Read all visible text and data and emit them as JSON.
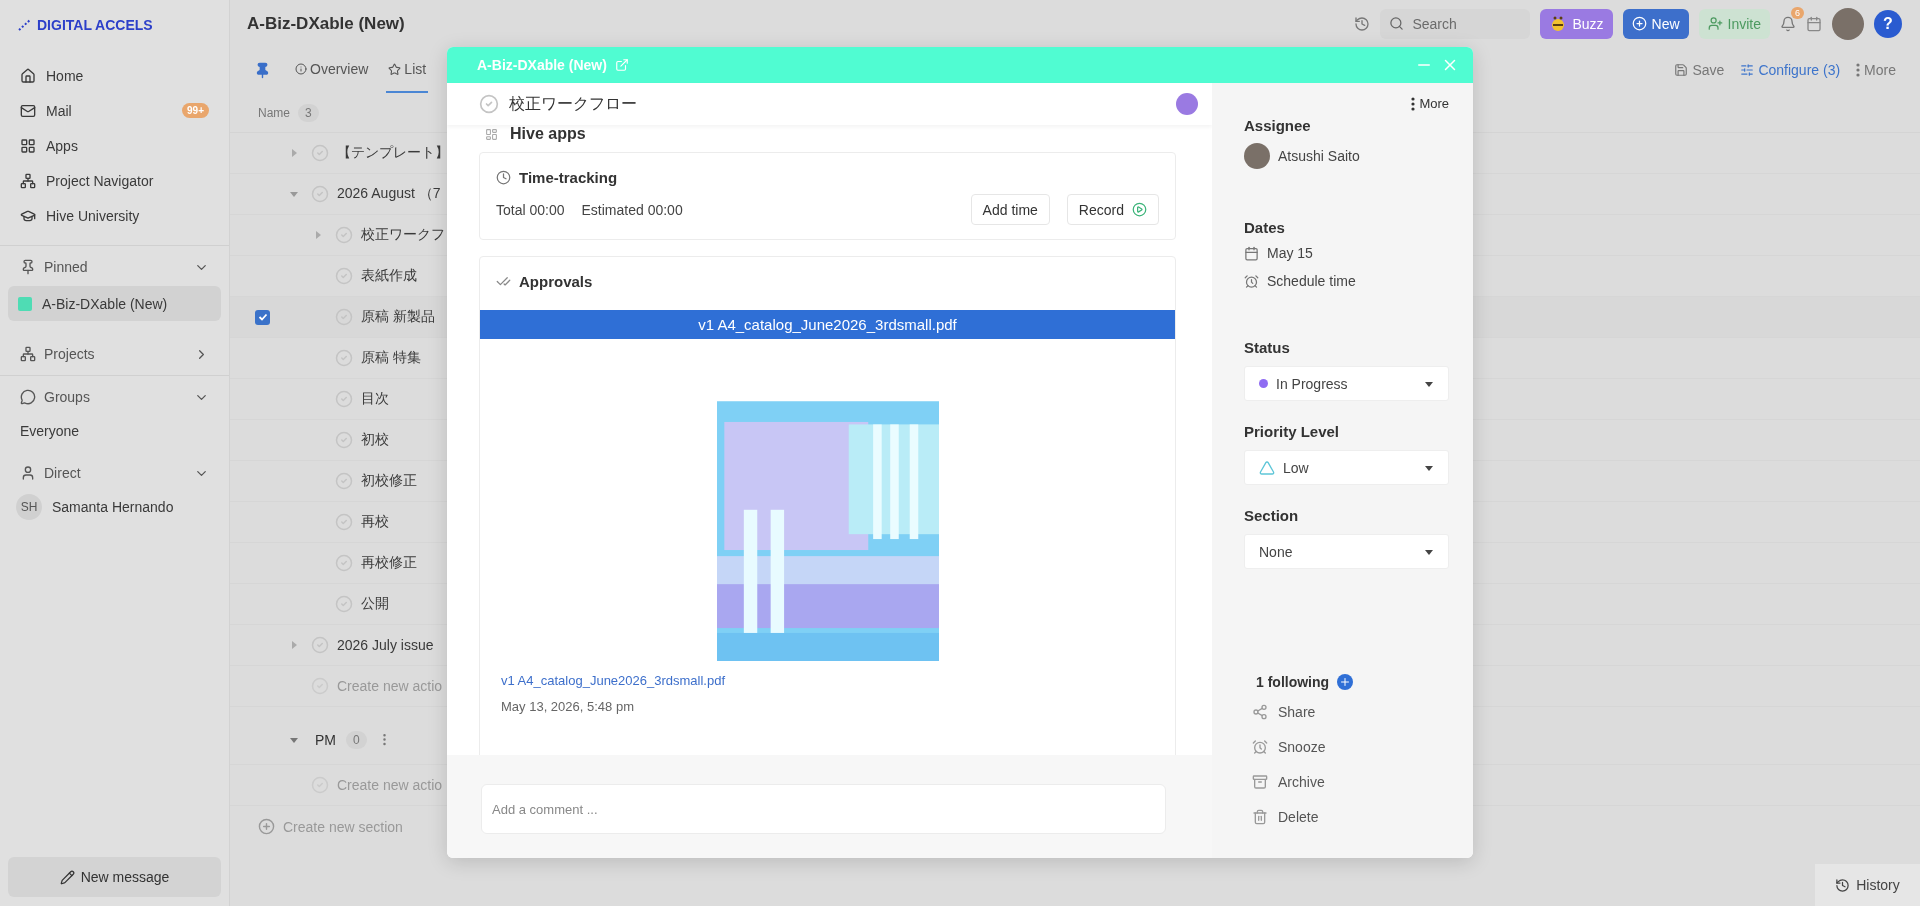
{
  "sidebar": {
    "brand": "DIGITAL ACCELS",
    "nav": [
      {
        "label": "Home"
      },
      {
        "label": "Mail",
        "badge": "99+"
      },
      {
        "label": "Apps"
      },
      {
        "label": "Project Navigator"
      },
      {
        "label": "Hive University"
      }
    ],
    "pinned": {
      "label": "Pinned",
      "expanded": true,
      "items": [
        {
          "label": "A-Biz-DXable (New)",
          "selected": true,
          "color": "#4fdcb4"
        }
      ]
    },
    "projects": {
      "label": "Projects",
      "expanded": false
    },
    "groups": {
      "label": "Groups",
      "expanded": true,
      "items": [
        "Everyone"
      ]
    },
    "direct": {
      "label": "Direct",
      "expanded": true,
      "items": [
        {
          "initials": "SH",
          "name": "Samanta Hernando"
        }
      ]
    },
    "new_message": "New message"
  },
  "topbar": {
    "title": "A-Biz-DXable (New)",
    "search_placeholder": "Search",
    "buttons": [
      {
        "label": "Buzz",
        "kind": "buzz"
      },
      {
        "label": "New",
        "kind": "new"
      },
      {
        "label": "Invite",
        "kind": "invite"
      }
    ],
    "notifications": "6",
    "help": "?"
  },
  "tabs": [
    {
      "label": "Overview",
      "selected": false
    },
    {
      "label": "List",
      "selected": true
    }
  ],
  "toolbar": [
    {
      "label": "Save",
      "active": false
    },
    {
      "label": "Configure (3)",
      "active": true
    },
    {
      "label": "More",
      "active": false
    }
  ],
  "list": {
    "column": "Name",
    "count": "3",
    "rows": [
      {
        "label": "【テンプレート】",
        "expanded": false,
        "selected": false
      },
      {
        "label": "2026 August （7",
        "expanded": true,
        "selected": false,
        "children": [
          {
            "label": "校正ワークフ",
            "expanded": false,
            "selected": false
          },
          {
            "label": "表紙作成",
            "selected": false
          },
          {
            "label": "原稿 新製品",
            "selected": true
          },
          {
            "label": "原稿 特集",
            "selected": false
          },
          {
            "label": "目次",
            "selected": false
          },
          {
            "label": "初校",
            "selected": false
          },
          {
            "label": "初校修正",
            "selected": false
          },
          {
            "label": "再校",
            "selected": false
          },
          {
            "label": "再校修正",
            "selected": false
          },
          {
            "label": "公開",
            "selected": false
          }
        ]
      },
      {
        "label": "2026 July issue",
        "expanded": false,
        "selected": false
      }
    ],
    "new_row": "Create new actio",
    "sections": [
      {
        "name": "PM",
        "count": "0",
        "expanded": true,
        "new_row": "Create new actio"
      }
    ],
    "new_section": "Create new section"
  },
  "modal": {
    "title": "A-Biz-DXable (New)",
    "task": {
      "title": "校正ワークフロー",
      "done": false
    },
    "app_section": "Hive apps",
    "time_tracking": {
      "title": "Time-tracking",
      "total": "Total 00:00",
      "estimated": "Estimated 00:00",
      "buttons": [
        "Add time",
        "Record"
      ]
    },
    "approvals": {
      "title": "Approvals",
      "file_bar": "v1 A4_catalog_June2026_3rdsmall.pdf",
      "file_link": "v1 A4_catalog_June2026_3rdsmall.pdf",
      "date": "May 13, 2026, 5:48 pm"
    },
    "comment_placeholder": "Add a comment ...",
    "panel": {
      "more": "More",
      "assignee": {
        "label": "Assignee",
        "name": "Atsushi Saito"
      },
      "dates": {
        "label": "Dates",
        "due": "May 15",
        "schedule": "Schedule time"
      },
      "fields": [
        {
          "label": "Status",
          "value": "In Progress",
          "kind": "status",
          "color": "#8f6cf2"
        },
        {
          "label": "Priority Level",
          "value": "Low",
          "kind": "priority"
        },
        {
          "label": "Section",
          "value": "None",
          "kind": "plain"
        }
      ],
      "following": "1 following",
      "actions": [
        "Share",
        "Snooze",
        "Archive",
        "Delete"
      ]
    }
  },
  "history": "History"
}
